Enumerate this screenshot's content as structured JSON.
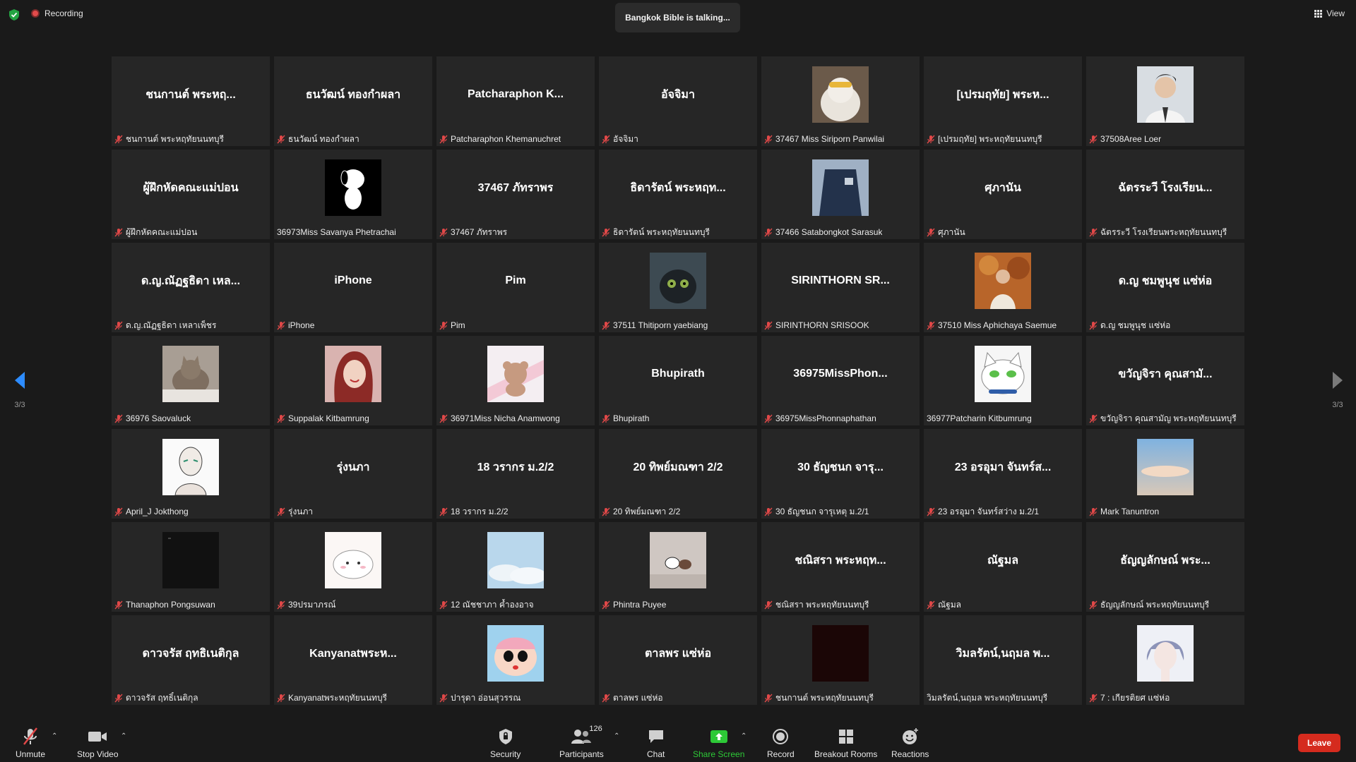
{
  "top": {
    "recording_label": "Recording",
    "talking_text": "Bangkok Bible is talking...",
    "view_label": "View"
  },
  "pagination": {
    "left": "3/3",
    "right": "3/3"
  },
  "tiles": [
    {
      "title": "ชนกานต์ พระหฤ...",
      "name": "ชนกานต์ พระหฤทัยนนทบุรี",
      "muted": true
    },
    {
      "title": "ธนวัฒน์ ทองกำผลา",
      "name": "ธนวัฒน์ ทองกำผลา",
      "muted": true
    },
    {
      "title": "Patcharaphon K...",
      "name": "Patcharaphon Khemanuchret",
      "muted": true
    },
    {
      "title": "อัจจิมา",
      "name": "อัจจิมา",
      "muted": true
    },
    {
      "title": "",
      "name": "37467 Miss Siriporn Panwilai",
      "muted": true,
      "avatar": "cat-photo"
    },
    {
      "title": "[เปรมฤทัย] พระห...",
      "name": "[เปรมฤทัย] พระหฤทัยนนทบุรี",
      "muted": true
    },
    {
      "title": "",
      "name": "37508Aree Loer",
      "muted": true,
      "avatar": "person-photo"
    },
    {
      "title": "ผู้ฝึกหัดคณะแม่ปอน",
      "name": "ผู้ฝึกหัดคณะแม่ปอน",
      "muted": true
    },
    {
      "title": "",
      "name": "36973Miss Savanya Phetrachai",
      "muted": false,
      "avatar": "snoopy-drawing"
    },
    {
      "title": "37467 ภัทราพร",
      "name": "37467 ภัทราพร",
      "muted": true
    },
    {
      "title": "ธิดารัตน์ พระหฤท...",
      "name": "ธิดารัตน์ พระหฤทัยนนทบุรี",
      "muted": true
    },
    {
      "title": "",
      "name": "37466 Satabongkot Sarasuk",
      "muted": true,
      "avatar": "uniform-photo"
    },
    {
      "title": "ศุภานัน",
      "name": "ศุภานัน",
      "muted": true
    },
    {
      "title": "ฉัตรระวี โรงเรียน...",
      "name": "ฉัตรระวี โรงเรียนพระหฤทัยนนทบุรี",
      "muted": true
    },
    {
      "title": "ด.ญ.ณัฏฐธิดา เหล...",
      "name": "ด.ญ.ณัฏฐธิดา เหลาเพ็ชร",
      "muted": true
    },
    {
      "title": "iPhone",
      "name": "iPhone",
      "muted": true
    },
    {
      "title": "Pim",
      "name": "Pim",
      "muted": true
    },
    {
      "title": "",
      "name": "37511 Thitiporn yaebiang",
      "muted": true,
      "avatar": "dragon-photo"
    },
    {
      "title": "SIRINTHORN SR...",
      "name": "SIRINTHORN SRISOOK",
      "muted": true
    },
    {
      "title": "",
      "name": "37510 Miss Aphichaya Saemue",
      "muted": true,
      "avatar": "autumn-photo"
    },
    {
      "title": "ด.ญ ชมพูนุช แซ่ห่อ",
      "name": "ด.ญ ชมพูนุช แซ่ห่อ",
      "muted": true
    },
    {
      "title": "",
      "name": "36976 Saovaluck",
      "muted": true,
      "avatar": "kitten-photo"
    },
    {
      "title": "",
      "name": "Suppalak Kitbamrung",
      "muted": true,
      "avatar": "princess-drawing"
    },
    {
      "title": "",
      "name": "36971Miss Nicha Anamwong",
      "muted": true,
      "avatar": "bear-drawing"
    },
    {
      "title": "Bhupirath",
      "name": "Bhupirath",
      "muted": true
    },
    {
      "title": "36975MissPhon...",
      "name": "36975MissPhonnaphathan",
      "muted": true
    },
    {
      "title": "",
      "name": "36977Patcharin Kitbumrung",
      "muted": false,
      "avatar": "white-cat-drawing"
    },
    {
      "title": "ขวัญจิรา คุณสามั...",
      "name": "ขวัญจิรา คุณสามัญ พระหฤทัยนนทบุรี",
      "muted": true
    },
    {
      "title": "",
      "name": "April_J Jokthong",
      "muted": true,
      "avatar": "sketch-drawing"
    },
    {
      "title": "รุ่งนภา",
      "name": "รุ่งนภา",
      "muted": true
    },
    {
      "title": "18 วรากร ม.2/2",
      "name": "18 วรากร ม.2/2",
      "muted": true
    },
    {
      "title": "20 ทิพย์มณฑา 2/2",
      "name": "20 ทิพย์มณฑา 2/2",
      "muted": true
    },
    {
      "title": "30 ธัญชนก   จารุ...",
      "name": "30 ธัญชนก   จารุเหตุ ม.2/1",
      "muted": true
    },
    {
      "title": "23 อรอุมา จันทร์ส...",
      "name": "23 อรอุมา จันทร์สว่าง ม.2/1",
      "muted": true
    },
    {
      "title": "",
      "name": "Mark Tanuntron",
      "muted": true,
      "avatar": "sky-photo"
    },
    {
      "title": "",
      "name": "Thanaphon Pongsuwan",
      "muted": true,
      "avatar": "dark-image"
    },
    {
      "title": "",
      "name": "39ปรมาภรณ์",
      "muted": true,
      "avatar": "mochi-drawing"
    },
    {
      "title": "",
      "name": "12 ณัชชาภา ค้ำองอาจ",
      "muted": true,
      "avatar": "cloud-photo"
    },
    {
      "title": "",
      "name": "Phintra Puyee",
      "muted": true,
      "avatar": "figurine-photo"
    },
    {
      "title": "ชณิสรา พระหฤท...",
      "name": "ชณิสรา พระหฤทัยนนทบุรี",
      "muted": true
    },
    {
      "title": "ณัฐมล",
      "name": "ณัฐมล",
      "muted": true
    },
    {
      "title": "ธัญญลักษณ์ พระ...",
      "name": "ธัญญลักษณ์ พระหฤทัยนนทบุรี",
      "muted": true
    },
    {
      "title": "ดาวจรัส ฤทธิเนติกุล",
      "name": "ดาวจรัส ฤทธิ์เนติกุล",
      "muted": true
    },
    {
      "title": "Kanyanatพระห...",
      "name": "Kanyanatพระหฤทัยนนทบุรี",
      "muted": true
    },
    {
      "title": "",
      "name": "ปารุดา อ่อนสุวรรณ",
      "muted": true,
      "avatar": "shinchan-drawing"
    },
    {
      "title": "ตาลพร แซ่ห่อ",
      "name": "ตาลพร แซ่ห่อ",
      "muted": true
    },
    {
      "title": "",
      "name": "ชนกานต์ พระหฤทัยนนทบุรี",
      "muted": true,
      "avatar": "dark-red-image"
    },
    {
      "title": "วิมลรัตน์,นฤมล พ...",
      "name": "วิมลรัตน์,นฤมล พระหฤทัยนนทบุรี",
      "muted": false
    },
    {
      "title": "",
      "name": "7 : เกียรติยศ แซ่ห่อ",
      "muted": true,
      "avatar": "anime-boy-drawing"
    }
  ],
  "toolbar": {
    "unmute": "Unmute",
    "stop_video": "Stop Video",
    "security": "Security",
    "participants": "Participants",
    "participants_count": "126",
    "chat": "Chat",
    "share_screen": "Share Screen",
    "record": "Record",
    "breakout_rooms": "Breakout Rooms",
    "reactions": "Reactions",
    "leave": "Leave"
  },
  "colors": {
    "accent_blue": "#2d8cff",
    "share_green": "#2dc937",
    "leave_red": "#d52b1e",
    "mute_red": "#e04848"
  }
}
